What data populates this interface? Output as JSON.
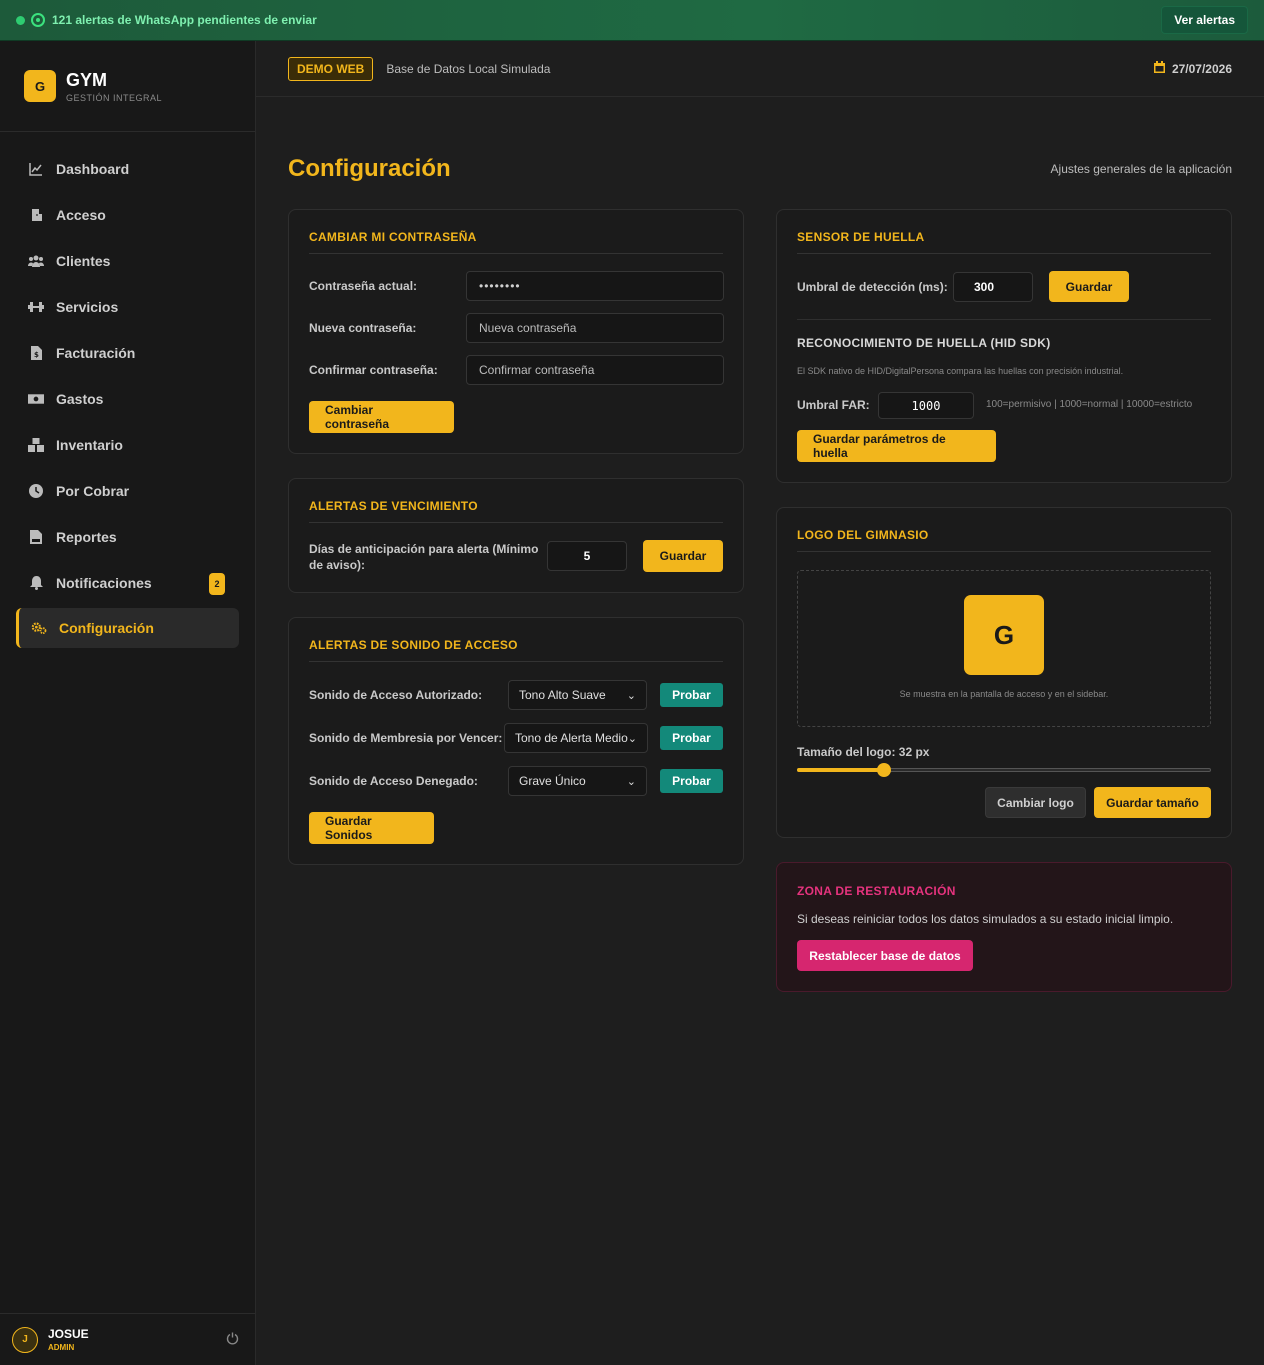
{
  "topbar": {
    "message": "121 alertas de WhatsApp pendientes de enviar",
    "button": "Ver alertas"
  },
  "brand": {
    "logo_letter": "G",
    "name": "GYM",
    "tagline": "GESTIÓN INTEGRAL"
  },
  "nav": [
    {
      "label": "Dashboard",
      "icon": "chart-line-icon"
    },
    {
      "label": "Acceso",
      "icon": "door-icon"
    },
    {
      "label": "Clientes",
      "icon": "users-icon"
    },
    {
      "label": "Servicios",
      "icon": "dumbbell-icon"
    },
    {
      "label": "Facturación",
      "icon": "invoice-icon"
    },
    {
      "label": "Gastos",
      "icon": "money-icon"
    },
    {
      "label": "Inventario",
      "icon": "boxes-icon"
    },
    {
      "label": "Por Cobrar",
      "icon": "clock-icon"
    },
    {
      "label": "Reportes",
      "icon": "pdf-file-icon"
    },
    {
      "label": "Notificaciones",
      "icon": "bell-icon",
      "badge": "2"
    },
    {
      "label": "Configuración",
      "icon": "gears-icon",
      "active": true
    }
  ],
  "user": {
    "initial": "J",
    "name": "JOSUE",
    "role": "ADMIN"
  },
  "header": {
    "badge": "DEMO WEB",
    "subtitle": "Base de Datos Local Simulada",
    "date": "27/07/2026"
  },
  "page": {
    "title": "Configuración",
    "subtitle": "Ajustes generales de la aplicación"
  },
  "password": {
    "title": "CAMBIAR MI CONTRASEÑA",
    "current_label": "Contraseña actual:",
    "current_value": "••••••••",
    "new_label": "Nueva contraseña:",
    "new_placeholder": "Nueva contraseña",
    "confirm_label": "Confirmar contraseña:",
    "confirm_placeholder": "Confirmar contraseña",
    "button": "Cambiar contraseña"
  },
  "expiry": {
    "title": "ALERTAS DE VENCIMIENTO",
    "label": "Días de anticipación para alerta (Mínimo de aviso):",
    "value": "5",
    "button": "Guardar"
  },
  "sounds": {
    "title": "ALERTAS DE SONIDO DE ACCESO",
    "rows": [
      {
        "label": "Sonido de Acceso Autorizado:",
        "value": "Tono Alto Suave",
        "button": "Probar"
      },
      {
        "label": "Sonido de Membresia por Vencer:",
        "value": "Tono de Alerta Medio",
        "button": "Probar"
      },
      {
        "label": "Sonido de Acceso Denegado:",
        "value": "Grave Único",
        "button": "Probar"
      }
    ],
    "button": "Guardar Sonidos"
  },
  "fingerprint": {
    "title": "SENSOR DE HUELLA",
    "threshold_label": "Umbral de detección (ms):",
    "threshold_value": "300",
    "save": "Guardar",
    "sdk_title": "RECONOCIMIENTO DE HUELLA (HID SDK)",
    "sdk_desc": "El SDK nativo de HID/DigitalPersona compara las huellas con precisión industrial.",
    "far_label": "Umbral FAR:",
    "far_value": "1000",
    "far_hint": "100=permisivo | 1000=normal | 10000=estricto",
    "sdk_button": "Guardar parámetros de huella"
  },
  "logo": {
    "title": "LOGO DEL GIMNASIO",
    "letter": "G",
    "caption": "Se muestra en la pantalla de acceso y en el sidebar.",
    "size_label": "Tamaño del logo: 32 px",
    "size_fraction": 0.21,
    "change_button": "Cambiar logo",
    "save_button": "Guardar tamaño"
  },
  "restore": {
    "title": "ZONA DE RESTAURACIÓN",
    "desc": "Si deseas reiniciar todos los datos simulados a su estado inicial limpio.",
    "button": "Restablecer base de datos"
  },
  "colors": {
    "accent": "#f2b61c",
    "teal": "#13897a",
    "danger": "#d6266f"
  }
}
